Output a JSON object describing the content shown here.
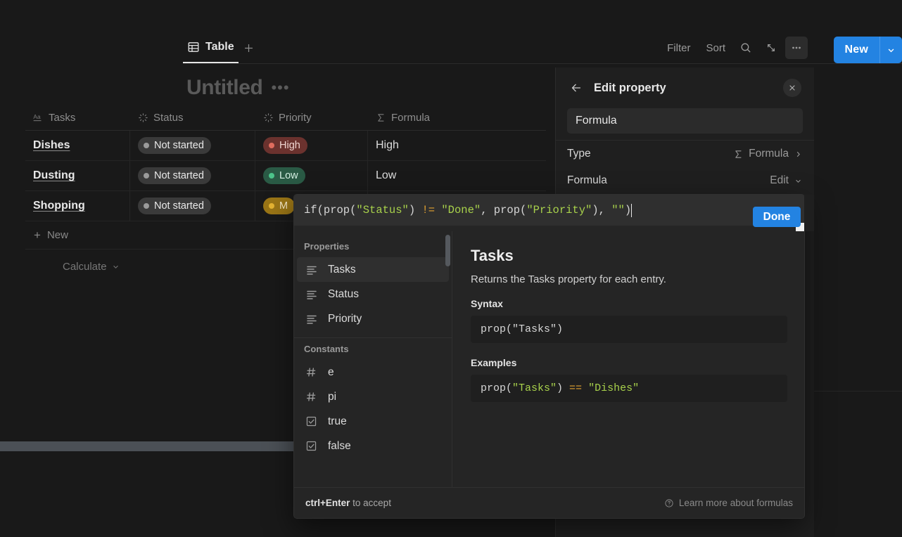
{
  "tabs": [
    {
      "label": "Table",
      "icon": "table-icon",
      "active": true
    }
  ],
  "tab_add_label": "+",
  "toolbar": {
    "filter_label": "Filter",
    "sort_label": "Sort",
    "search_icon": "search-icon",
    "expand_icon": "expand-icon",
    "more_icon": "ellipsis-icon",
    "new_label": "New",
    "new_caret_icon": "chevron-down-icon"
  },
  "page": {
    "title": "Untitled",
    "title_menu": "•••"
  },
  "table": {
    "columns": [
      {
        "label": "Tasks",
        "icon": "text-aa-icon"
      },
      {
        "label": "Status",
        "icon": "status-spinner-icon"
      },
      {
        "label": "Priority",
        "icon": "status-spinner-icon"
      },
      {
        "label": "Formula",
        "icon": "sigma-icon"
      }
    ],
    "rows": [
      {
        "task": "Dishes",
        "status": {
          "label": "Not started",
          "dot": "#9a9a9a",
          "bg": "#3a3a3a"
        },
        "priority": {
          "label": "High",
          "dot": "#e06c5e",
          "bg": "#6b322e",
          "text": "#f0d6d2"
        },
        "formula": "High"
      },
      {
        "task": "Dusting",
        "status": {
          "label": "Not started",
          "dot": "#9a9a9a",
          "bg": "#3a3a3a"
        },
        "priority": {
          "label": "Low",
          "dot": "#4cc38a",
          "bg": "#2a5a45",
          "text": "#d6f0e3"
        },
        "formula": "Low"
      },
      {
        "task": "Shopping",
        "status": {
          "label": "Not started",
          "dot": "#9a9a9a",
          "bg": "#3a3a3a"
        },
        "priority": {
          "label": "M",
          "dot": "#e5b432",
          "bg": "#9a7516",
          "text": "#f5e8c6"
        },
        "formula": ""
      }
    ],
    "new_row_label": "New",
    "calculate_label": "Calculate"
  },
  "side_panel": {
    "title": "Edit property",
    "back_icon": "arrow-left-icon",
    "close_icon": "close-icon",
    "name_value": "Formula",
    "type_label": "Type",
    "type_value": "Formula",
    "type_icon": "sigma-icon",
    "formula_label": "Formula",
    "formula_action": "Edit"
  },
  "formula_editor": {
    "input_tokens": [
      {
        "t": "if(prop(",
        "k": "plain"
      },
      {
        "t": "\"Status\"",
        "k": "str"
      },
      {
        "t": ") ",
        "k": "plain"
      },
      {
        "t": "!=",
        "k": "op"
      },
      {
        "t": " ",
        "k": "plain"
      },
      {
        "t": "\"Done\"",
        "k": "str"
      },
      {
        "t": ", prop(",
        "k": "plain"
      },
      {
        "t": "\"Priority\"",
        "k": "str"
      },
      {
        "t": "), ",
        "k": "plain"
      },
      {
        "t": "\"\"",
        "k": "str"
      },
      {
        "t": ")",
        "k": "plain"
      }
    ],
    "input_text": "if(prop(\"Status\") != \"Done\", prop(\"Priority\"), \"\")",
    "groups": [
      {
        "heading": "Properties",
        "items": [
          {
            "label": "Tasks",
            "icon": "text-lines-icon",
            "selected": true
          },
          {
            "label": "Status",
            "icon": "text-lines-icon",
            "selected": false
          },
          {
            "label": "Priority",
            "icon": "text-lines-icon",
            "selected": false
          }
        ]
      },
      {
        "heading": "Constants",
        "items": [
          {
            "label": "e",
            "icon": "hash-icon",
            "selected": false
          },
          {
            "label": "pi",
            "icon": "hash-icon",
            "selected": false
          },
          {
            "label": "true",
            "icon": "checkbox-icon",
            "selected": false
          },
          {
            "label": "false",
            "icon": "checkbox-icon",
            "selected": false
          }
        ]
      }
    ],
    "doc": {
      "title": "Tasks",
      "description": "Returns the Tasks property for each entry.",
      "syntax_heading": "Syntax",
      "syntax_code": "prop(\"Tasks\")",
      "examples_heading": "Examples",
      "example_tokens": [
        {
          "t": "prop(",
          "k": "plain"
        },
        {
          "t": "\"Tasks\"",
          "k": "str"
        },
        {
          "t": ") ",
          "k": "plain"
        },
        {
          "t": "==",
          "k": "op"
        },
        {
          "t": " ",
          "k": "plain"
        },
        {
          "t": "\"Dishes\"",
          "k": "str"
        }
      ],
      "example_code": "prop(\"Tasks\") == \"Dishes\""
    },
    "footer": {
      "shortcut": "ctrl+Enter",
      "hint_rest": " to accept",
      "learn_label": "Learn more about formulas",
      "learn_icon": "question-circle-icon"
    },
    "done_label": "Done"
  },
  "colors": {
    "accent": "#2383e2",
    "surface": "#191919",
    "panel": "#1f1f1f",
    "popup": "#252525",
    "code_string": "#a8d14b",
    "code_operator": "#e0a030"
  }
}
